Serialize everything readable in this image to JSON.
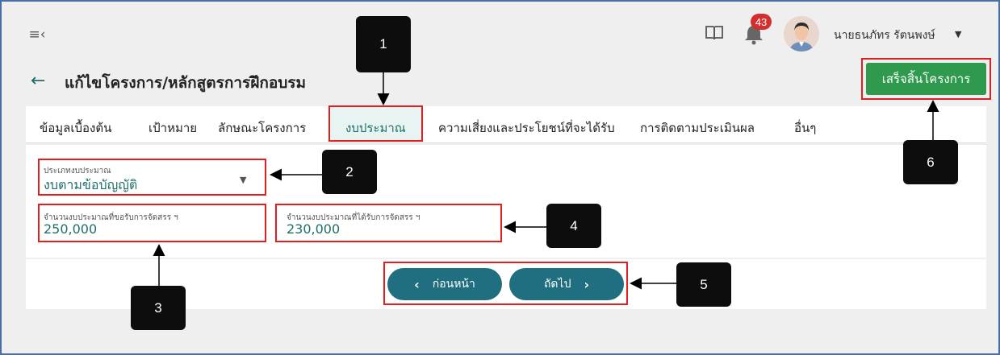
{
  "topbar": {
    "notification_count": "43",
    "user_name": "นายธนภัทร รัตนพงษ์"
  },
  "header": {
    "title": "แก้ไขโครงการ/หลักสูตรการฝึกอบรม",
    "finish_label": "เสร็จสิ้นโครงการ"
  },
  "tabs": [
    {
      "label": "ข้อมูลเบื้องต้น"
    },
    {
      "label": "เป้าหมาย"
    },
    {
      "label": "ลักษณะโครงการ"
    },
    {
      "label": "งบประมาณ"
    },
    {
      "label": "ความเสี่ยงและประโยชน์ที่จะได้รับ"
    },
    {
      "label": "การติดตามประเมินผล"
    },
    {
      "label": "อื่นๆ"
    }
  ],
  "form": {
    "budget_type": {
      "label": "ประเภทงบประมาณ",
      "value": "งบตามข้อบัญญัติ"
    },
    "requested": {
      "label": "จำนวนงบประมาณที่ขอรับการจัดสรร ฯ",
      "value": "250,000"
    },
    "allocated": {
      "label": "จำนวนงบประมาณที่ได้รับการจัดสรร ฯ",
      "value": "230,000"
    }
  },
  "nav": {
    "prev_label": "ก่อนหน้า",
    "next_label": "ถัดไป"
  },
  "callouts": [
    "1",
    "2",
    "3",
    "4",
    "5",
    "6"
  ],
  "colors": {
    "accent": "#1f6f6a",
    "finish_button": "#2f9a4e",
    "nav_button": "#1f6f80",
    "highlight_border": "#e02020",
    "badge": "#d32f2f"
  }
}
